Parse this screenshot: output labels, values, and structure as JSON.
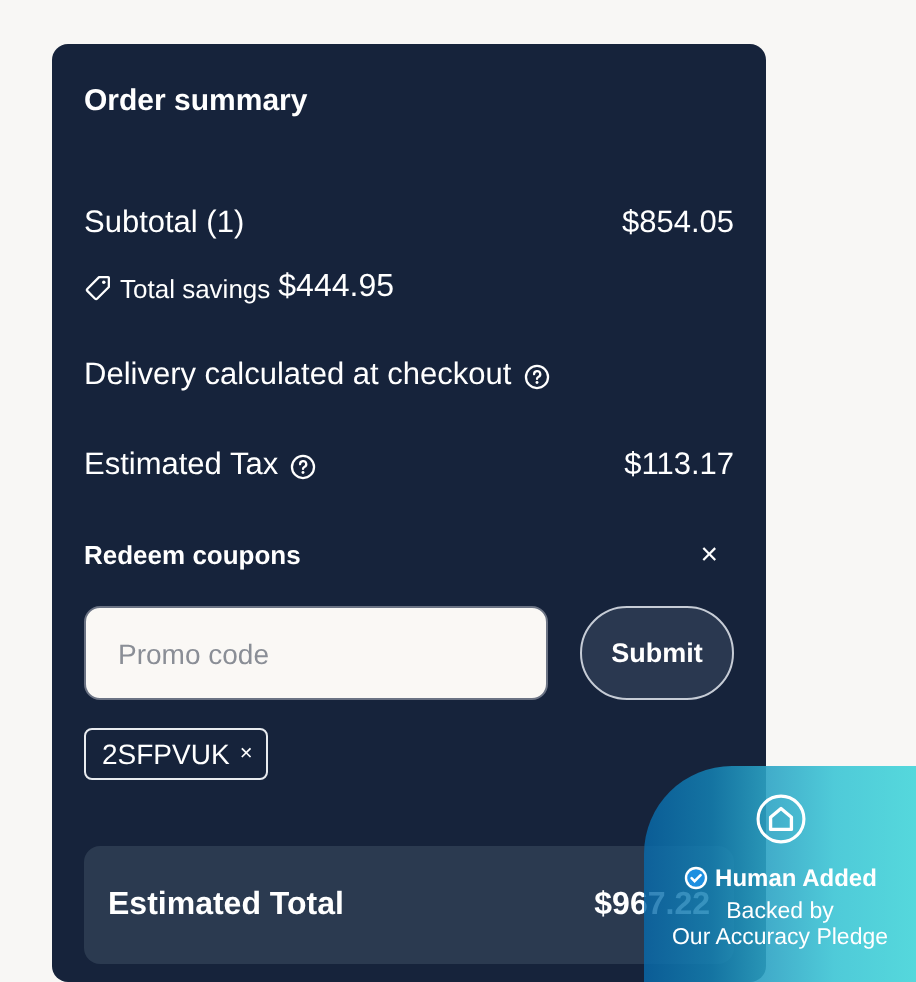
{
  "order_summary": {
    "title": "Order summary",
    "lines": [
      {
        "kind": "amount",
        "label": "Subtotal (1)",
        "value": "$854.05",
        "help": false
      },
      {
        "kind": "savings",
        "label": "Total savings",
        "value": "$444.95",
        "help": false
      },
      {
        "kind": "info",
        "label": "Delivery calculated at checkout",
        "help": true
      },
      {
        "kind": "amount",
        "label": "Estimated Tax",
        "value": "$113.17",
        "help": true
      }
    ],
    "coupons": {
      "title": "Redeem coupons",
      "close": "×",
      "placeholder": "Promo code",
      "button": "Submit",
      "applied": [
        {
          "code": "2SFPVUK",
          "remove": "×"
        }
      ]
    },
    "total": {
      "label": "Estimated Total",
      "value": "$967.22"
    }
  },
  "badge": {
    "title": "Human Added",
    "lines": [
      "Backed by",
      "Our Accuracy Pledge"
    ]
  }
}
